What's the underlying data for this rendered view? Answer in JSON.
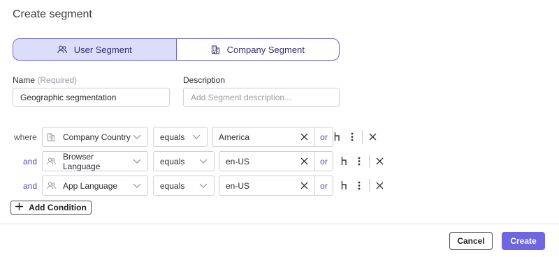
{
  "dialog": {
    "title": "Create segment"
  },
  "segment_type": {
    "options": [
      {
        "label": "User Segment",
        "icon": "users-icon",
        "active": true
      },
      {
        "label": "Company Segment",
        "icon": "building-icon",
        "active": false
      }
    ]
  },
  "form": {
    "name_label": "Name",
    "name_required": "(Required)",
    "name_value": "Geographic segmentation",
    "description_label": "Description",
    "description_placeholder": "Add Segment description..."
  },
  "conditions": [
    {
      "conjunction": "where",
      "property_icon": "building-icon",
      "property": "Company Country",
      "operator": "equals",
      "value": "America",
      "or_label": "or"
    },
    {
      "conjunction": "and",
      "property_icon": "users-icon",
      "property": "Browser Language",
      "operator": "equals",
      "value": "en-US",
      "or_label": "or"
    },
    {
      "conjunction": "and",
      "property_icon": "users-icon",
      "property": "App Language",
      "operator": "equals",
      "value": "en-US",
      "or_label": "or"
    }
  ],
  "add_condition_label": "Add Condition",
  "footer": {
    "cancel_label": "Cancel",
    "create_label": "Create"
  },
  "colors": {
    "accent": "#6f66e0",
    "accent_light": "#dcdcfb",
    "link": "#4f4ab8"
  }
}
